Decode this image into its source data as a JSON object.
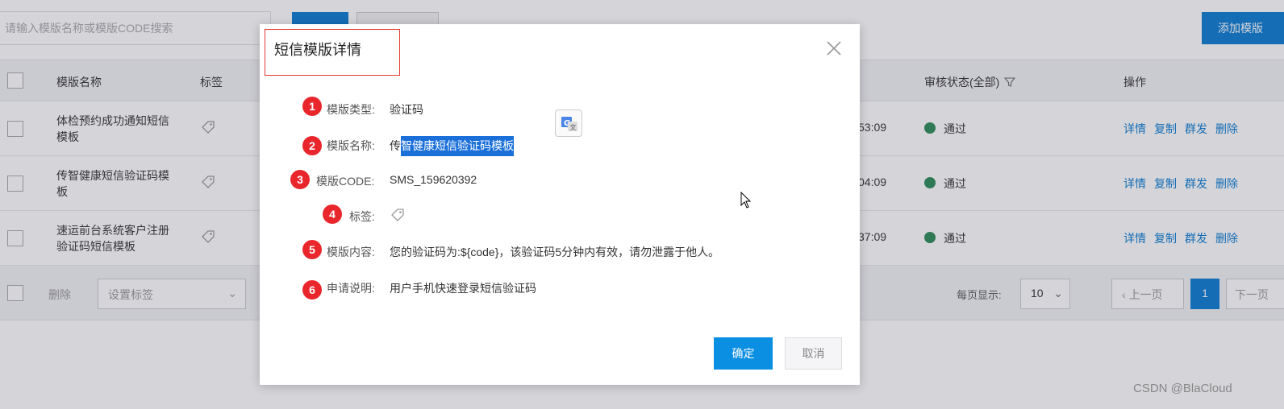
{
  "background": {
    "search_placeholder": "请输入模版名称或模版CODE搜索",
    "add_button": "添加模版",
    "table": {
      "headers": {
        "name": "模版名称",
        "tag": "标签",
        "status": "审核状态(全部)",
        "ops": "操作"
      },
      "rows": [
        {
          "name": "体检预约成功通知短信模板",
          "time": "53:09",
          "status": "通过"
        },
        {
          "name": "传智健康短信验证码模板",
          "time": "04:09",
          "status": "通过"
        },
        {
          "name": "速运前台系统客户注册验证码短信模板",
          "time": "37:09",
          "status": "通过"
        }
      ],
      "ops": [
        "详情",
        "复制",
        "群发",
        "删除"
      ]
    },
    "footer": {
      "delete": "删除",
      "tag_select": "设置标签",
      "per_page_label": "每页显示:",
      "per_page": "10",
      "prev": "上一页",
      "page": "1",
      "next": "下一页"
    }
  },
  "modal": {
    "title": "短信模版详情",
    "fields": [
      {
        "num": "1",
        "label": "模版类型:",
        "value": "验证码"
      },
      {
        "num": "2",
        "label": "模版名称:",
        "value_pre": "传",
        "value_sel": "智健康短信验证码模板"
      },
      {
        "num": "3",
        "label": "模版CODE:",
        "value": "SMS_159620392"
      },
      {
        "num": "4",
        "label": "标签:"
      },
      {
        "num": "5",
        "label": "模版内容:",
        "value": "您的验证码为:${code}，该验证码5分钟内有效，请勿泄露于他人。"
      },
      {
        "num": "6",
        "label": "申请说明:",
        "value": "用户手机快速登录短信验证码"
      }
    ],
    "ok": "确定",
    "cancel": "取消"
  },
  "watermark": "CSDN @BlaCloud",
  "colors": {
    "accent": "#0a7bd1",
    "badge": "#e8262c",
    "status_ok": "#2e8b57"
  }
}
